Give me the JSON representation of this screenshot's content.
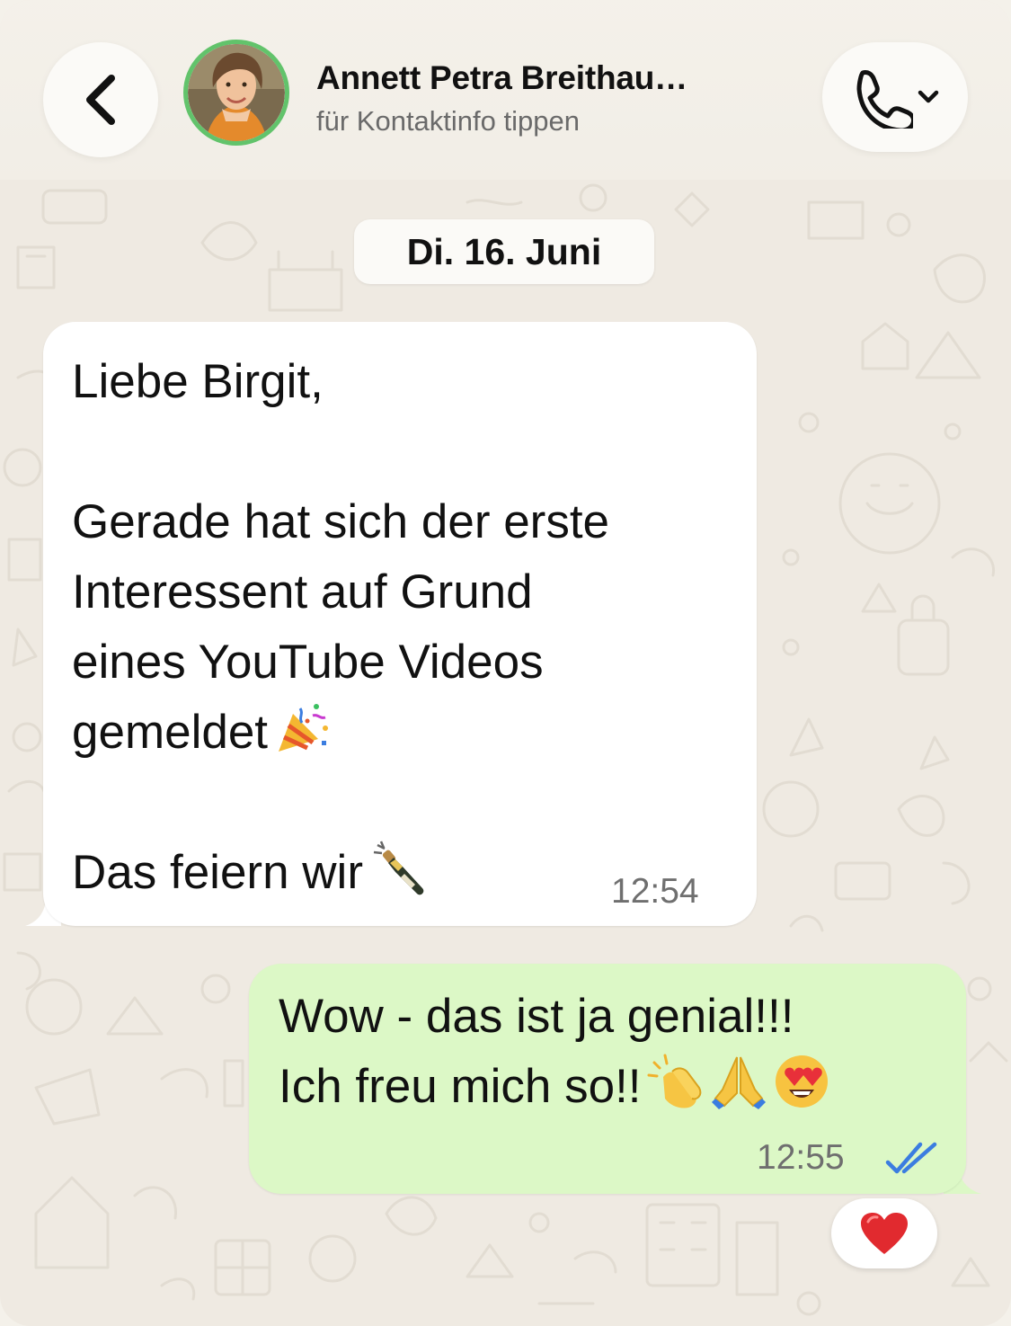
{
  "header": {
    "contact_name": "Annett Petra Breithau…",
    "contact_subtitle": "für Kontaktinfo tippen",
    "back_icon": "chevron-left-icon",
    "call_icon": "phone-icon",
    "call_menu_icon": "chevron-down-icon"
  },
  "chat": {
    "date_label": "Di. 16. Juni",
    "incoming": {
      "lines": [
        "Liebe Birgit,",
        "",
        "Gerade hat sich der erste",
        "Interessent auf Grund",
        "eines YouTube Videos",
        "gemeldet",
        "",
        "Das feiern wir"
      ],
      "emojis": [
        "party-popper-icon",
        "champagne-bottle-icon"
      ],
      "time": "12:54"
    },
    "outgoing": {
      "lines": [
        "Wow - das ist ja genial!!!",
        "Ich freu mich so!!"
      ],
      "emojis": [
        "clapping-hands-icon",
        "folded-hands-icon",
        "heart-eyes-icon"
      ],
      "time": "12:55",
      "status_icon": "double-check-icon"
    },
    "reaction_icon": "red-heart-icon"
  },
  "colors": {
    "background": "#efeae2",
    "incoming_bubble": "#ffffff",
    "outgoing_bubble": "#dcf8c6",
    "online_ring": "#62c36b",
    "read_tick": "#3b7de0",
    "timestamp": "#6f6f6f"
  }
}
